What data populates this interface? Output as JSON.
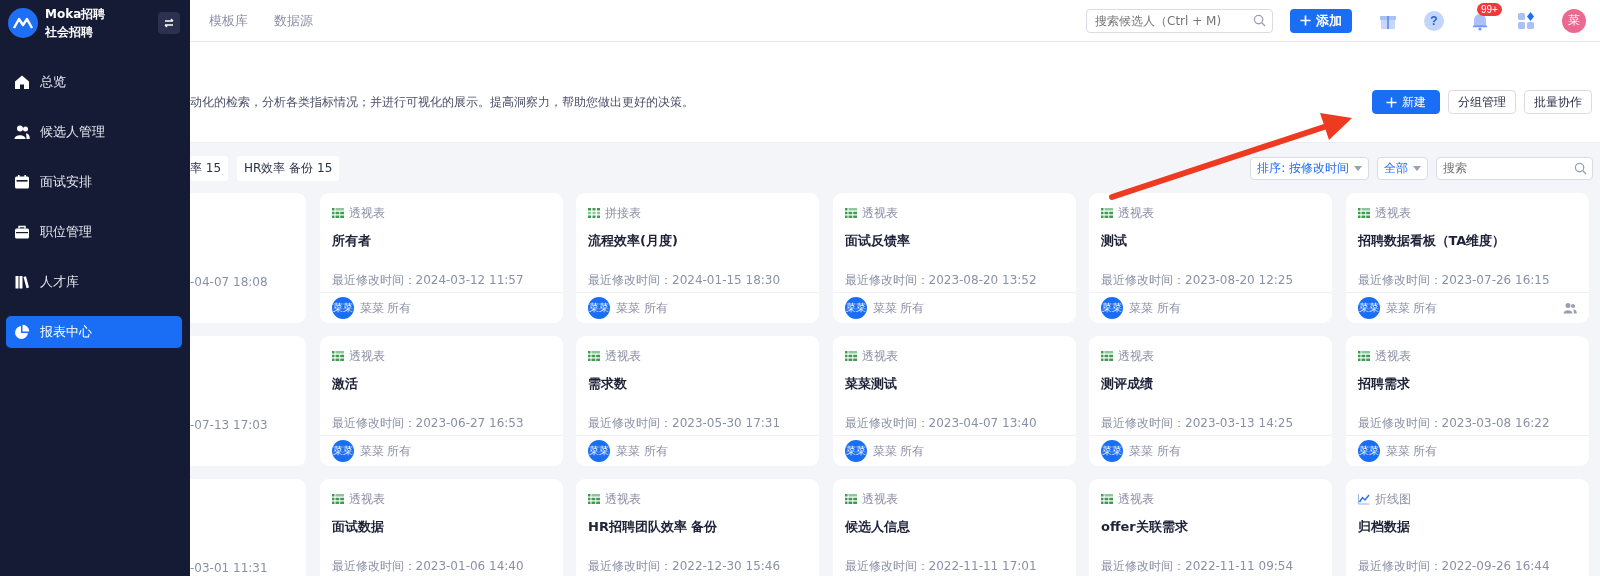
{
  "sidebar": {
    "brand": "Moka招聘",
    "subtitle": "社会招聘",
    "items": [
      {
        "label": "总览",
        "selected": false
      },
      {
        "label": "候选人管理",
        "selected": false
      },
      {
        "label": "面试安排",
        "selected": false
      },
      {
        "label": "职位管理",
        "selected": false
      },
      {
        "label": "人才库",
        "selected": false
      },
      {
        "label": "报表中心",
        "selected": true
      }
    ]
  },
  "topbar": {
    "tabs": [
      {
        "label": "模板库",
        "selected": false
      },
      {
        "label": "数据源",
        "selected": false
      }
    ],
    "search": {
      "placeholder": "搜索候选人（Ctrl + M)"
    },
    "add_button": "添加",
    "help_mark": "?",
    "notification_badge": "99+",
    "avatar": "菜"
  },
  "header": {
    "description": "动化的检索，分析各类指标情况；并进行可视化的展示。提高洞察力，帮助您做出更好的决策。",
    "buttons": [
      {
        "label": "新建",
        "primary": true
      },
      {
        "label": "分组管理",
        "primary": false
      },
      {
        "label": "批量协作",
        "primary": false
      }
    ]
  },
  "filters": {
    "groups": [
      "率 15",
      "HR效率 备份 15"
    ],
    "sort": "排序: 按修改时间",
    "scope": "全部",
    "search": {
      "placeholder": "搜索"
    }
  },
  "rows": [
    {
      "clipped_date": "-04-07 18:08",
      "cards": [
        {
          "kind": "pivot",
          "type": "透视表",
          "title": "所有者",
          "modified": "最近修改时间：2024-03-12 11:57",
          "avatar": "菜菜",
          "owner": "菜菜 所有",
          "shared": false
        },
        {
          "kind": "join",
          "type": "拼接表",
          "title": "流程效率(月度)",
          "modified": "最近修改时间：2024-01-15 18:30",
          "avatar": "菜菜",
          "owner": "菜菜 所有",
          "shared": false
        },
        {
          "kind": "pivot",
          "type": "透视表",
          "title": "面试反馈率",
          "modified": "最近修改时间：2023-08-20 13:52",
          "avatar": "菜菜",
          "owner": "菜菜 所有",
          "shared": false
        },
        {
          "kind": "pivot",
          "type": "透视表",
          "title": "测试",
          "modified": "最近修改时间：2023-08-20 12:25",
          "avatar": "菜菜",
          "owner": "菜菜 所有",
          "shared": false
        },
        {
          "kind": "pivot",
          "type": "透视表",
          "title": "招聘数据看板（TA维度）",
          "modified": "最近修改时间：2023-07-26 16:15",
          "avatar": "菜菜",
          "owner": "菜菜 所有",
          "shared": true
        }
      ]
    },
    {
      "clipped_date": "-07-13 17:03",
      "cards": [
        {
          "kind": "pivot",
          "type": "透视表",
          "title": "激活",
          "modified": "最近修改时间：2023-06-27 16:53",
          "avatar": "菜菜",
          "owner": "菜菜 所有",
          "shared": false
        },
        {
          "kind": "pivot",
          "type": "透视表",
          "title": "需求数",
          "modified": "最近修改时间：2023-05-30 17:31",
          "avatar": "菜菜",
          "owner": "菜菜 所有",
          "shared": false
        },
        {
          "kind": "pivot",
          "type": "透视表",
          "title": "菜菜测试",
          "modified": "最近修改时间：2023-04-07 13:40",
          "avatar": "菜菜",
          "owner": "菜菜 所有",
          "shared": false
        },
        {
          "kind": "pivot",
          "type": "透视表",
          "title": "测评成绩",
          "modified": "最近修改时间：2023-03-13 14:25",
          "avatar": "菜菜",
          "owner": "菜菜 所有",
          "shared": false
        },
        {
          "kind": "pivot",
          "type": "透视表",
          "title": "招聘需求",
          "modified": "最近修改时间：2023-03-08 16:22",
          "avatar": "菜菜",
          "owner": "菜菜 所有",
          "shared": false
        }
      ]
    },
    {
      "clipped_date": "-03-01 11:31",
      "cards": [
        {
          "kind": "pivot",
          "type": "透视表",
          "title": "面试数据",
          "modified": "最近修改时间：2023-01-06 14:40"
        },
        {
          "kind": "pivot",
          "type": "透视表",
          "title": "HR招聘团队效率 备份",
          "modified": "最近修改时间：2022-12-30 15:46"
        },
        {
          "kind": "pivot",
          "type": "透视表",
          "title": "候选人信息",
          "modified": "最近修改时间：2022-11-11 17:01"
        },
        {
          "kind": "pivot",
          "type": "透视表",
          "title": "offer关联需求",
          "modified": "最近修改时间：2022-11-11 09:54"
        },
        {
          "kind": "line",
          "type": "折线图",
          "title": "归档数据",
          "modified": "最近修改时间：2022-09-26 16:44"
        }
      ]
    }
  ]
}
